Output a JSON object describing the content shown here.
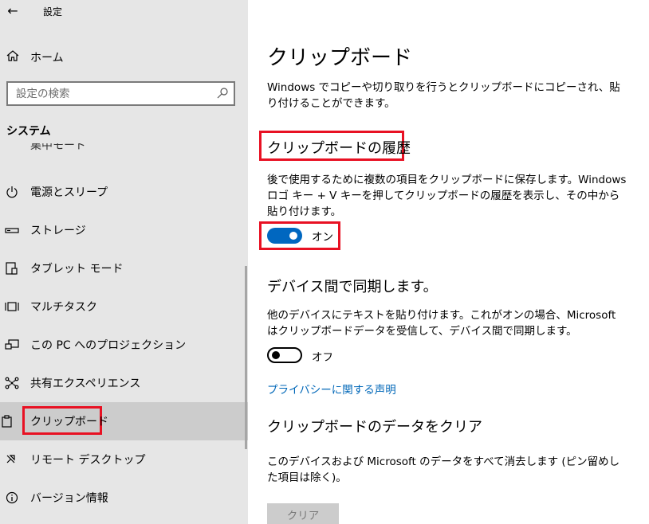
{
  "window": {
    "title": "設定"
  },
  "home": {
    "label": "ホーム"
  },
  "search": {
    "placeholder": "設定の検索"
  },
  "sidebar": {
    "section_title": "システム",
    "partial_item": "集中モード",
    "items": [
      {
        "label": "電源とスリープ",
        "icon": "power-icon"
      },
      {
        "label": "ストレージ",
        "icon": "storage-icon"
      },
      {
        "label": "タブレット モード",
        "icon": "tablet-icon"
      },
      {
        "label": "マルチタスク",
        "icon": "multitask-icon"
      },
      {
        "label": "この PC へのプロジェクション",
        "icon": "projection-icon"
      },
      {
        "label": "共有エクスペリエンス",
        "icon": "shared-icon"
      },
      {
        "label": "クリップボード",
        "icon": "clipboard-icon",
        "selected": true
      },
      {
        "label": "リモート デスクトップ",
        "icon": "remote-icon"
      },
      {
        "label": "バージョン情報",
        "icon": "info-icon"
      }
    ]
  },
  "main": {
    "title": "クリップボード",
    "description": "Windows でコピーや切り取りを行うとクリップボードにコピーされ、貼り付けることができます。",
    "history": {
      "heading": "クリップボードの履歴",
      "description": "後で使用するために複数の項目をクリップボードに保存します。Windows ロゴ キー + V キーを押してクリップボードの履歴を表示し、その中から貼り付けます。",
      "toggle_label": "オン",
      "toggle_state": "on"
    },
    "sync": {
      "heading": "デバイス間で同期します。",
      "description": "他のデバイスにテキストを貼り付けます。これがオンの場合、Microsoft はクリップボードデータを受信して、デバイス間で同期します。",
      "toggle_label": "オフ",
      "toggle_state": "off"
    },
    "privacy_link": "プライバシーに関する声明",
    "clear": {
      "heading": "クリップボードのデータをクリア",
      "description": "このデバイスおよび Microsoft のデータをすべて消去します (ピン留めした項目は除く)。",
      "button_label": "クリア"
    }
  },
  "colors": {
    "accent": "#0067c0",
    "highlight": "#e81123",
    "link": "#0067b8"
  }
}
